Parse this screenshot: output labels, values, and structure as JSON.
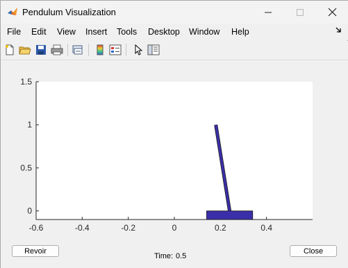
{
  "window": {
    "title": "Pendulum Visualization",
    "minimize_icon": "minimize-icon",
    "maximize_icon": "maximize-icon",
    "close_icon": "close-icon"
  },
  "menu": {
    "items": [
      "File",
      "Edit",
      "View",
      "Insert",
      "Tools",
      "Desktop",
      "Window",
      "Help"
    ],
    "dock_icon": "dock-arrow-icon"
  },
  "toolbar": {
    "icons": [
      "new-figure-icon",
      "open-file-icon",
      "save-icon",
      "print-icon",
      "link-plot-icon",
      "colorbar-icon",
      "legend-icon",
      "edit-plot-arrow-icon",
      "property-inspector-icon"
    ]
  },
  "chart_data": {
    "type": "line",
    "xlim": [
      -0.6,
      0.6
    ],
    "ylim": [
      -0.1,
      1.5
    ],
    "xticks": [
      "-0.6",
      "-0.4",
      "-0.2",
      "0",
      "0.2",
      "0.4"
    ],
    "yticks": [
      "0",
      "0.5",
      "1",
      "1.5"
    ],
    "xtick_values": [
      -0.6,
      -0.4,
      -0.2,
      0,
      0.2,
      0.4
    ],
    "ytick_values": [
      0,
      0.5,
      1,
      1.5
    ],
    "cart": {
      "x_center": 0.24,
      "half_width": 0.1,
      "y_bottom": -0.1,
      "y_top": 0.0,
      "color": "#3a2fa8"
    },
    "pendulum": {
      "pivot": [
        0.24,
        0.0
      ],
      "bob": [
        0.18,
        1.0
      ],
      "color": "#3a2fa8"
    },
    "background": "#ffffff",
    "grid": false
  },
  "controls": {
    "revoir_label": "Revoir",
    "close_label": "Close",
    "time_caption": "Time:",
    "time_value": "0.5"
  }
}
